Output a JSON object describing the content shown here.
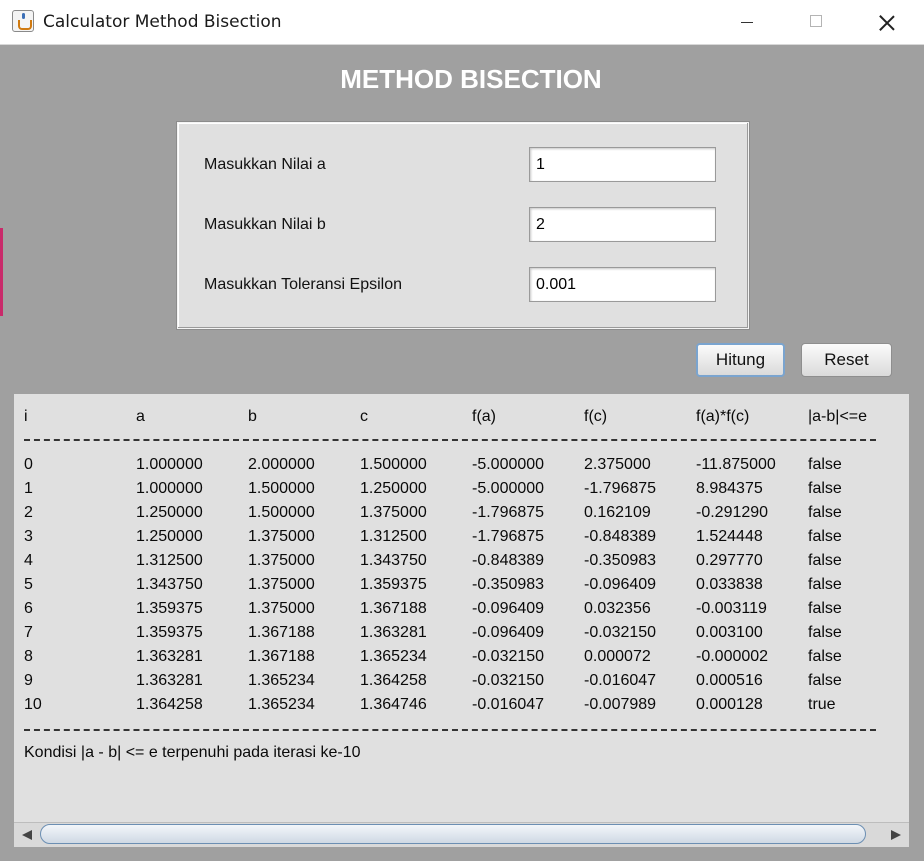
{
  "window": {
    "title": "Calculator Method Bisection",
    "icon": "java-cup-icon",
    "controls": [
      "minimize-icon",
      "maximize-icon",
      "close-icon"
    ]
  },
  "heading": "METHOD BISECTION",
  "form": {
    "a_label": "Masukkan Nilai a",
    "a_value": "1",
    "b_label": "Masukkan Nilai b",
    "b_value": "2",
    "eps_label": "Masukkan Toleransi Epsilon",
    "eps_value": "0.001"
  },
  "buttons": {
    "hitung": "Hitung",
    "reset": "Reset"
  },
  "result": {
    "headers": [
      "i",
      "a",
      "b",
      "c",
      "f(a)",
      "f(c)",
      "f(a)*f(c)",
      "|a-b|<=e"
    ],
    "separator": "---------------------------------------------------------------------------------------------------------------------------------------------------",
    "rows": [
      [
        "0",
        "1.000000",
        "2.000000",
        "1.500000",
        "-5.000000",
        "2.375000",
        "-11.875000",
        "false"
      ],
      [
        "1",
        "1.000000",
        "1.500000",
        "1.250000",
        "-5.000000",
        "-1.796875",
        "8.984375",
        "false"
      ],
      [
        "2",
        "1.250000",
        "1.500000",
        "1.375000",
        "-1.796875",
        "0.162109",
        "-0.291290",
        "false"
      ],
      [
        "3",
        "1.250000",
        "1.375000",
        "1.312500",
        "-1.796875",
        "-0.848389",
        "1.524448",
        "false"
      ],
      [
        "4",
        "1.312500",
        "1.375000",
        "1.343750",
        "-0.848389",
        "-0.350983",
        "0.297770",
        "false"
      ],
      [
        "5",
        "1.343750",
        "1.375000",
        "1.359375",
        "-0.350983",
        "-0.096409",
        "0.033838",
        "false"
      ],
      [
        "6",
        "1.359375",
        "1.375000",
        "1.367188",
        "-0.096409",
        "0.032356",
        "-0.003119",
        "false"
      ],
      [
        "7",
        "1.359375",
        "1.367188",
        "1.363281",
        "-0.096409",
        "-0.032150",
        "0.003100",
        "false"
      ],
      [
        "8",
        "1.363281",
        "1.367188",
        "1.365234",
        "-0.032150",
        "0.000072",
        "-0.000002",
        "false"
      ],
      [
        "9",
        "1.363281",
        "1.365234",
        "1.364258",
        "-0.032150",
        "-0.016047",
        "0.000516",
        "false"
      ],
      [
        "10",
        "1.364258",
        "1.365234",
        "1.364746",
        "-0.016047",
        "-0.007989",
        "0.000128",
        "true"
      ]
    ],
    "status": "Kondisi |a - b| <= e terpenuhi pada iterasi ke-10"
  },
  "colors": {
    "background": "#a0a0a0",
    "panel": "#e0e0e0",
    "heading": "#ffffff",
    "focus_border": "#7aa4cf"
  }
}
